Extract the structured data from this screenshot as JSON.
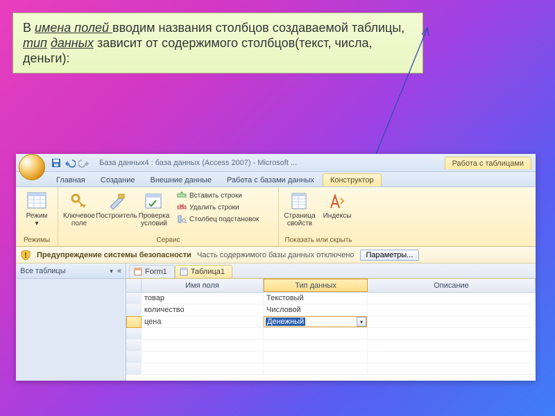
{
  "annotation": {
    "pre": "В ",
    "u1": "имена полей ",
    "mid1": "вводим названия столбцов создаваемой таблицы, ",
    "u2": "тип",
    "sp": " ",
    "u3": "данных",
    "mid2": " зависит от содержимого столбцов(текст, числа, деньги):"
  },
  "title": "База данных4 : база данных (Access 2007) - Microsoft ...",
  "context_tab": "Работа с таблицами",
  "tabs": {
    "home": "Главная",
    "create": "Создание",
    "external": "Внешние данные",
    "dbtools": "Работа с базами данных",
    "design": "Конструктор"
  },
  "ribbon": {
    "mode": "Режим",
    "mode_arrow": "▾",
    "modes_group": "Режимы",
    "key": "Ключевое поле",
    "builder": "Построитель",
    "validate": "Проверка условий",
    "insert_rows": "Вставить строки",
    "delete_rows": "Удалить строки",
    "lookup_col": "Столбец подстановок",
    "service_group": "Сервис",
    "prop_page": "Страница свойств",
    "indexes": "Индексы",
    "showhide_group": "Показать или скрыть"
  },
  "warn": {
    "title": "Предупреждение системы безопасности",
    "msg": "Часть содержимого базы данных отключено",
    "btn": "Параметры..."
  },
  "nav": {
    "header": "Все таблицы",
    "chev": "▾",
    "collapse": "«"
  },
  "doctabs": {
    "form": "Form1",
    "table": "Таблица1"
  },
  "grid": {
    "col_name": "Имя поля",
    "col_type": "Тип данных",
    "col_desc": "Описание",
    "rows": [
      {
        "name": "товар",
        "type": "Текстовый"
      },
      {
        "name": "количество",
        "type": "Числовой"
      },
      {
        "name": "цена",
        "type": "Денежный"
      }
    ],
    "dd_arrow": "▾"
  }
}
